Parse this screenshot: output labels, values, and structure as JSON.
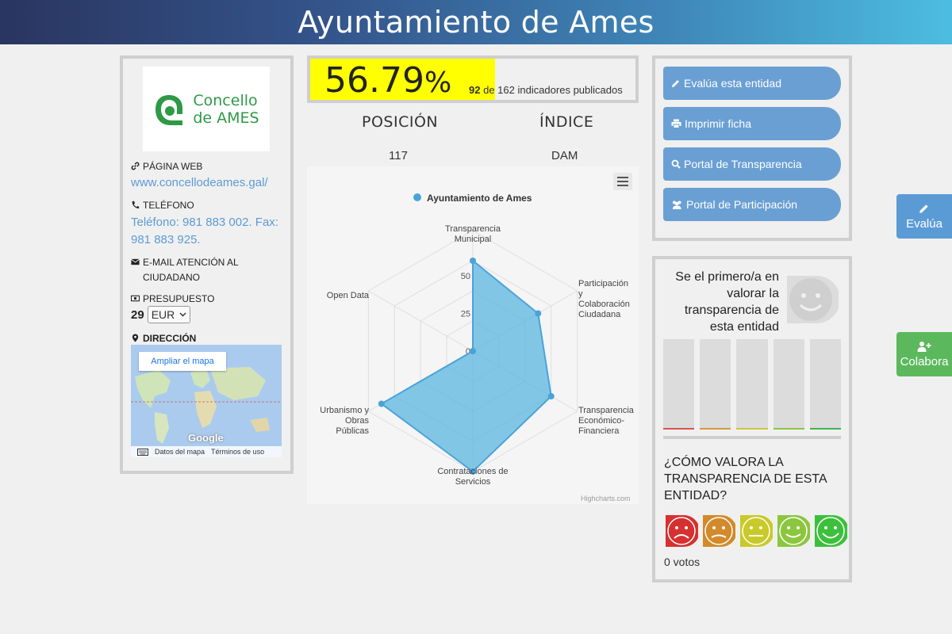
{
  "header": {
    "title": "Ayuntamiento de Ames"
  },
  "entity": {
    "logo_line1": "Concello",
    "logo_line2": "de AMES",
    "web_label": "PÁGINA WEB",
    "web_value": "www.concellodeames.gal/",
    "phone_label": "TELÉFONO",
    "phone_value": "Teléfono: 981 883 002. Fax: 981 883 925.",
    "email_label": "E-MAIL ATENCIÓN AL CIUDADANO",
    "budget_label": "PRESUPUESTO",
    "budget_value": "29",
    "currency": "EUR",
    "address_label": "DIRECCIÓN",
    "map_button": "Ampliar el mapa",
    "map_brand": "Google",
    "map_data": "Datos del mapa",
    "map_terms": "Términos de uso"
  },
  "score": {
    "percent": "56.79",
    "unit": "%",
    "percent_value": 56.79,
    "published": "92",
    "of_text": "de 162 indicadores publicados"
  },
  "stats": {
    "position_label": "POSICIÓN",
    "position_value": "117",
    "index_label": "ÍNDICE",
    "index_value": "DAM"
  },
  "chart_data": {
    "type": "radar",
    "legend": "Ayuntamiento de Ames",
    "axes": [
      "Transparencia Municipal",
      "Participación y Colaboración Ciudadana",
      "Transparencia Económico-Financiera",
      "Contrataciones de Servicios",
      "Urbanismo y Obras Públicas",
      "Open Data"
    ],
    "values": [
      60,
      50,
      60,
      80,
      70,
      0
    ],
    "ticks": [
      "0",
      "25",
      "50"
    ],
    "max": 80,
    "credit": "Highcharts.com",
    "color": "#5bb5e0"
  },
  "actions": {
    "evaluate": "Evalúa esta entidad",
    "print": "Imprimir ficha",
    "transparency": "Portal de Transparencia",
    "participation": "Portal de Participación"
  },
  "rating": {
    "first_text": "Se el primero/a en valorar la transparencia de esta entidad",
    "question": "¿CÓMO VALORA LA TRANSPARENCIA DE ESTA ENTIDAD?",
    "votes": "0 votos",
    "bar_base_colors": [
      "#d9534f",
      "#d39a3e",
      "#c9c93a",
      "#8cc63f",
      "#3cb44a"
    ],
    "face_colors": [
      "#d63030",
      "#d38a2a",
      "#c9c92a",
      "#8cc63f",
      "#3cc03c"
    ]
  },
  "side": {
    "evaluate": "Evalúa",
    "collaborate": "Colabora"
  }
}
